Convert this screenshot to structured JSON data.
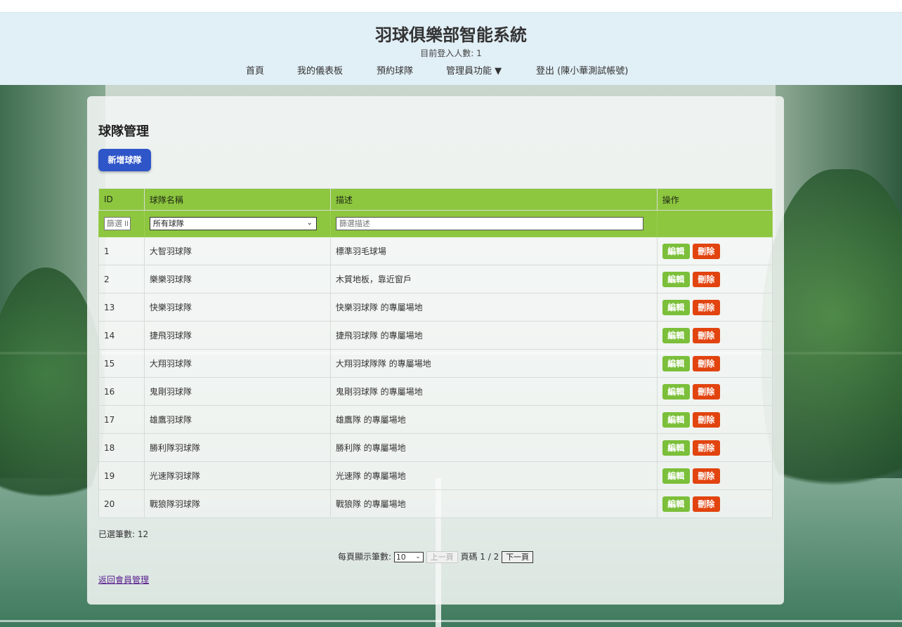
{
  "header": {
    "title": "羽球俱樂部智能系統",
    "online_label": "目前登入人數: 1",
    "nav": [
      {
        "label": "首頁"
      },
      {
        "label": "我的儀表板"
      },
      {
        "label": "預約球隊"
      },
      {
        "label": "管理員功能 ▼"
      },
      {
        "label": "登出 (陳小華測試帳號)"
      }
    ]
  },
  "main": {
    "title": "球隊管理",
    "add_button": "新增球隊",
    "table": {
      "columns": [
        "ID",
        "球隊名稱",
        "描述",
        "操作"
      ],
      "filters": {
        "id_placeholder": "篩選 ID",
        "name_selected": "所有球隊",
        "desc_placeholder": "篩選描述"
      },
      "rows": [
        {
          "id": "1",
          "name": "大智羽球隊",
          "desc": "標準羽毛球場"
        },
        {
          "id": "2",
          "name": "樂樂羽球隊",
          "desc": "木質地板，靠近窗戶"
        },
        {
          "id": "13",
          "name": "快樂羽球隊",
          "desc": "快樂羽球隊 的專屬場地"
        },
        {
          "id": "14",
          "name": "捷飛羽球隊",
          "desc": "捷飛羽球隊 的專屬場地"
        },
        {
          "id": "15",
          "name": "大翔羽球隊",
          "desc": "大翔羽球隊隊 的專屬場地"
        },
        {
          "id": "16",
          "name": "鬼剛羽球隊",
          "desc": "鬼剛羽球隊 的專屬場地"
        },
        {
          "id": "17",
          "name": "雄鷹羽球隊",
          "desc": "雄鷹隊 的專屬場地"
        },
        {
          "id": "18",
          "name": "勝利隊羽球隊",
          "desc": "勝利隊 的專屬場地"
        },
        {
          "id": "19",
          "name": "光速隊羽球隊",
          "desc": "光速隊 的專屬場地"
        },
        {
          "id": "20",
          "name": "戰狼隊羽球隊",
          "desc": "戰狼隊 的專屬場地"
        }
      ],
      "edit_label": "編輯",
      "delete_label": "刪除"
    },
    "selected_count": "已選筆數: 12",
    "pager": {
      "per_page_label": "每頁顯示筆數:",
      "per_page_value": "10",
      "prev_label": "上一頁",
      "page_label": "頁碼 1 / 2",
      "next_label": "下一頁"
    },
    "back_link": "返回會員管理"
  },
  "colors": {
    "header_bg": "#e1eff6",
    "table_header": "#8dc63f",
    "add_button": "#2f56c8",
    "edit_button": "#7bbf3a",
    "delete_button": "#e2440f"
  }
}
